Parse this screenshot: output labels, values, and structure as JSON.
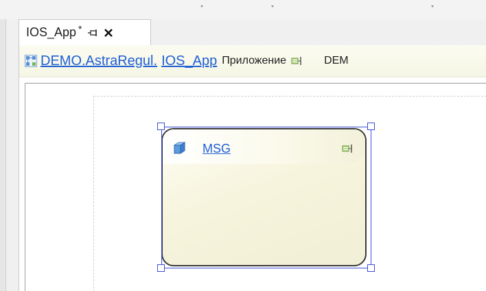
{
  "tab": {
    "title": "IOS_App",
    "modified_marker": "*",
    "pin_icon": "pin-icon",
    "close_icon": "close-icon"
  },
  "breadcrumb": {
    "icon": "diagram-grid-icon",
    "segments": [
      "DEMO.AstraRegul.",
      "IOS_App"
    ],
    "type_label": "Приложение",
    "type_icon": "interface-icon",
    "tail": "DEM"
  },
  "component": {
    "name": "MSG",
    "icon": "module-cube-icon",
    "badge_icon": "interface-icon"
  },
  "colors": {
    "link": "#1e5fd6",
    "selection": "#3a4bd9",
    "component_fill": "#f6f4dc",
    "breadcrumb_bg": "#f8f8ea"
  }
}
